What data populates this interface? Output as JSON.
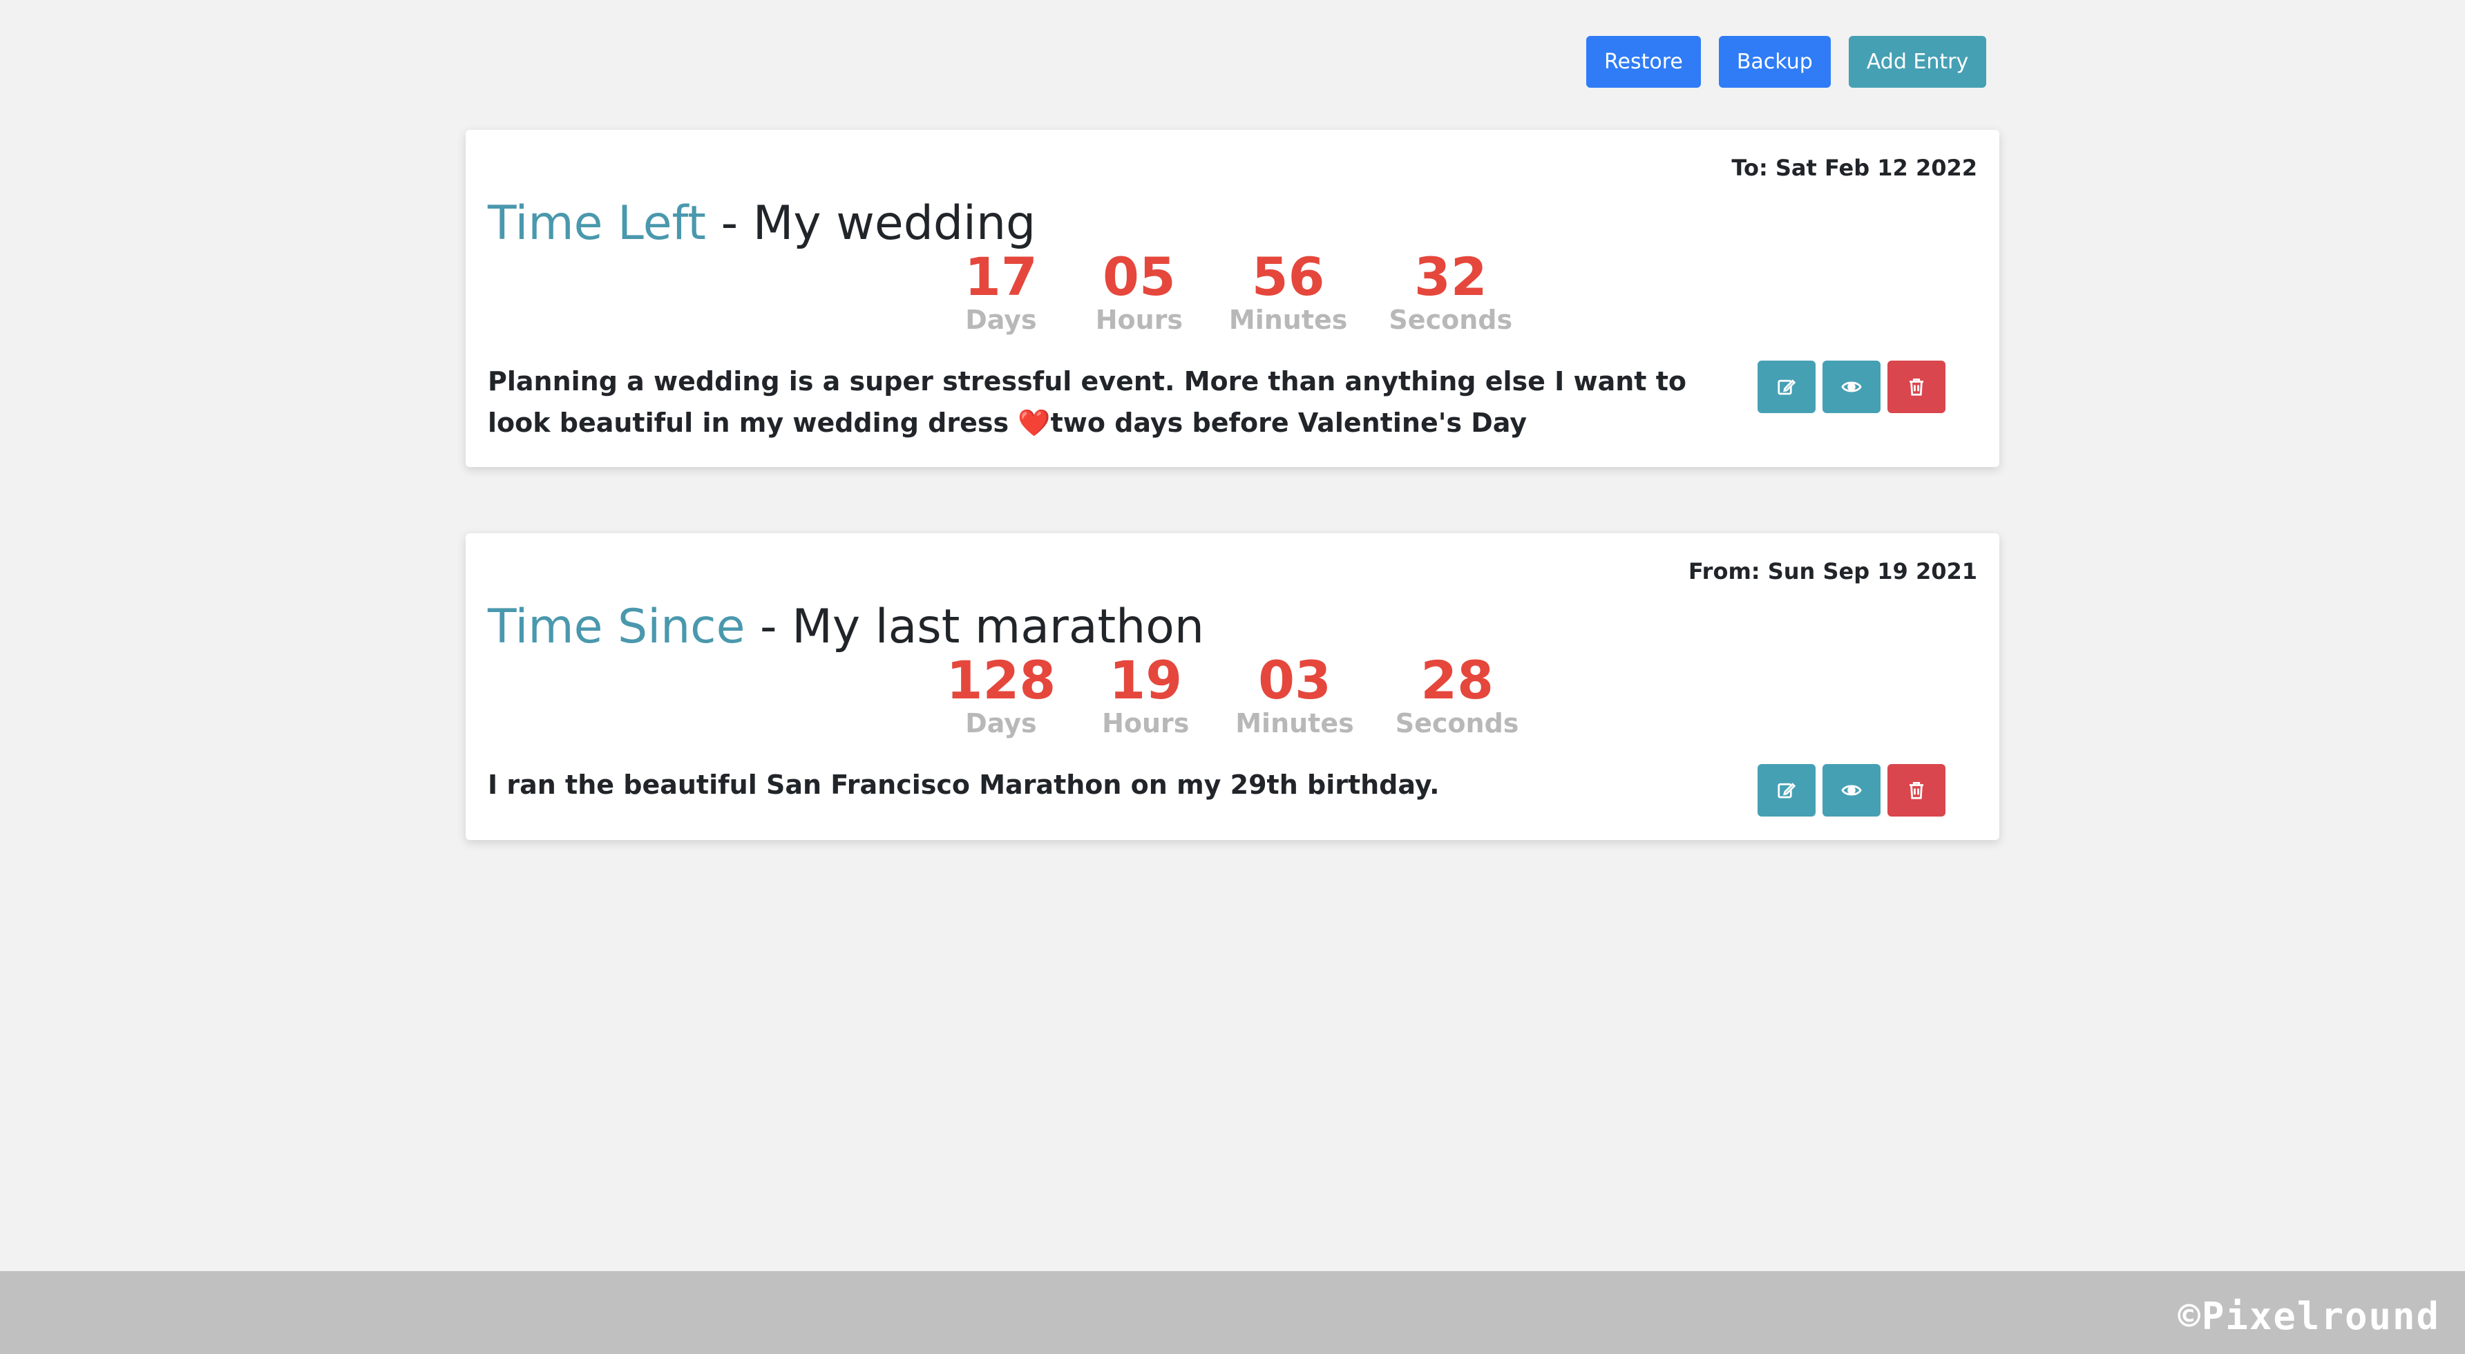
{
  "toolbar": {
    "restore_label": "Restore",
    "backup_label": "Backup",
    "add_entry_label": "Add Entry"
  },
  "entries": [
    {
      "kind": "Time Left",
      "separator": " - ",
      "name": "My wedding",
      "date_label": "To: Sat Feb 12 2022",
      "counters": {
        "days": "17",
        "hours": "05",
        "minutes": "56",
        "seconds": "32"
      },
      "description": "Planning a wedding is a super stressful event. More than anything else I want to look beautiful in my wedding dress ❤️two days before Valentine's Day"
    },
    {
      "kind": "Time Since",
      "separator": " - ",
      "name": "My last marathon",
      "date_label": "From: Sun Sep 19 2021",
      "counters": {
        "days": "128",
        "hours": "19",
        "minutes": "03",
        "seconds": "28"
      },
      "description": "I ran the beautiful San Francisco Marathon on my 29th birthday."
    }
  ],
  "counter_labels": {
    "days": "Days",
    "hours": "Hours",
    "minutes": "Minutes",
    "seconds": "Seconds"
  },
  "footer": {
    "brand": "©Pixelround"
  },
  "colors": {
    "primary": "#2f7cf6",
    "info": "#46a0b4",
    "danger": "#d9464d",
    "counter_value": "#e5473c",
    "title_kind": "#4a98ad"
  },
  "icons": {
    "edit": "edit-icon",
    "view": "eye-icon",
    "delete": "trash-icon"
  }
}
